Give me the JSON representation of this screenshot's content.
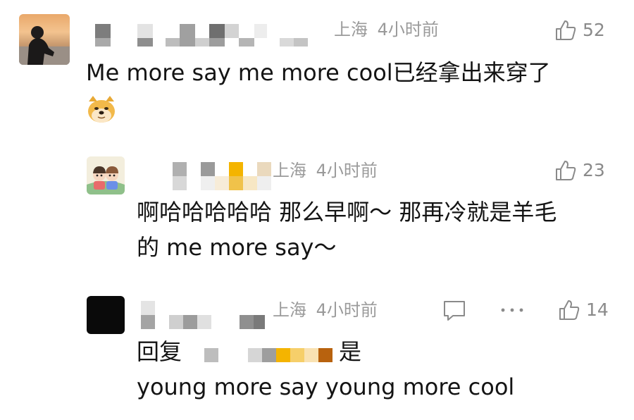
{
  "comments": [
    {
      "location": "上海",
      "time": "4小时前",
      "like_count": "52",
      "text": "Me more say me more cool已经拿出来穿了",
      "emoji": "doge-emoji"
    },
    {
      "location": "上海",
      "time": "4小时前",
      "like_count": "23",
      "text_line1": "啊哈哈哈哈哈 那么早啊～ 那再冷就是羊毛",
      "text_line2": "的 me more say～"
    },
    {
      "location": "上海",
      "time": "4小时前",
      "like_count": "14",
      "reply_prefix": "回复",
      "reply_suffix": "是",
      "text_line2": "young more say young more cool"
    }
  ],
  "icons": {
    "like": "thumbs-up-icon",
    "comment": "comment-bubble-icon",
    "more": "more-dots-icon"
  },
  "colors": {
    "meta_text": "#9a9a9a",
    "body_text": "#141414",
    "mosaic_gold": "#f4b400",
    "mosaic_brown": "#b8620e"
  }
}
